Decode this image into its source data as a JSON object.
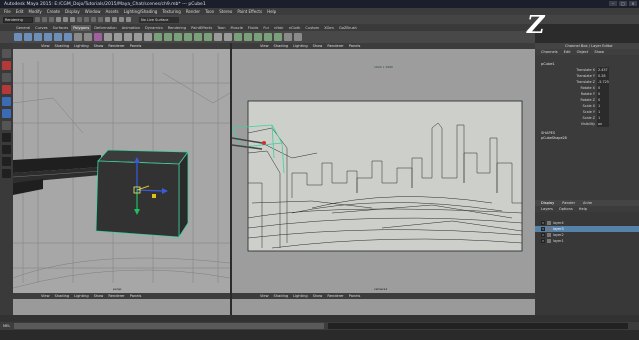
{
  "window": {
    "title": "Autodesk Maya 2015: E:/CGM_Dojo/Tutorials/2015/Maya_Chat/scenes/ch9.mb* --- pCube1",
    "controls": [
      "–",
      "□",
      "×"
    ]
  },
  "menubar": [
    "File",
    "Edit",
    "Modify",
    "Create",
    "Display",
    "Window",
    "Assets",
    "Lighting/Shading",
    "Texturing",
    "Render",
    "Toon",
    "Stereo",
    "Paint Effects",
    "Help"
  ],
  "status": {
    "mode": "Rendering",
    "live_surface": "No Live Surface"
  },
  "shelf_tabs": [
    "General",
    "Curves",
    "Surfaces",
    "Polygons",
    "Deformation",
    "Animation",
    "Dynamics",
    "Rendering",
    "PaintEffects",
    "Toon",
    "Muscle",
    "Fluids",
    "Fur",
    "nHair",
    "nCloth",
    "Custom",
    "XGen",
    "GoZBrush"
  ],
  "shelf_active": "Polygons",
  "logo": "Z",
  "panels": {
    "menu": [
      "View",
      "Shading",
      "Lighting",
      "Show",
      "Renderer",
      "Panels"
    ],
    "left_label": "persp",
    "right_label": "camera1",
    "right_resolution": "1920 x 1080"
  },
  "channel_box": {
    "header": "Channel Box / Layer Editor",
    "menu": [
      "Channels",
      "Edit",
      "Object",
      "Show"
    ],
    "object": "pCube1",
    "attributes": [
      {
        "name": "Translate X",
        "value": "2.437"
      },
      {
        "name": "Translate Y",
        "value": "0.28"
      },
      {
        "name": "Translate Z",
        "value": "-5.725"
      },
      {
        "name": "Rotate X",
        "value": "0"
      },
      {
        "name": "Rotate Y",
        "value": "0"
      },
      {
        "name": "Rotate Z",
        "value": "0"
      },
      {
        "name": "Scale X",
        "value": "1"
      },
      {
        "name": "Scale Y",
        "value": "1"
      },
      {
        "name": "Scale Z",
        "value": "1"
      },
      {
        "name": "Visibility",
        "value": "on"
      }
    ],
    "shapes_header": "SHAPES",
    "shape": "pCubeShape28"
  },
  "layer_editor": {
    "tabs": [
      "Display",
      "Render",
      "Anim"
    ],
    "active_tab": "Display",
    "menu": [
      "Layers",
      "Options",
      "Help"
    ],
    "layers": [
      {
        "label": "layer4",
        "selected": false
      },
      {
        "label": "layer3",
        "selected": true
      },
      {
        "label": "layer2",
        "selected": false
      },
      {
        "label": "layer1",
        "selected": false
      }
    ]
  },
  "command_line": {
    "label": "MEL"
  }
}
